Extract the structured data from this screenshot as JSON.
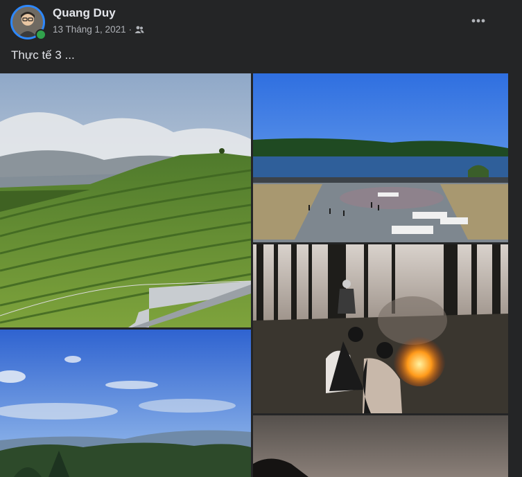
{
  "author": {
    "name": "Quang Duy",
    "online": true
  },
  "post": {
    "date": "13 Tháng 1, 2021",
    "separator": "·",
    "privacy_icon": "friends-icon",
    "text": "Thực tế 3 ...",
    "more_icon": "more-horizontal-icon"
  },
  "photos": [
    {
      "subject": "tea-hill"
    },
    {
      "subject": "lake-square"
    },
    {
      "subject": "blue-sky-mountains"
    },
    {
      "subject": "campfire-forest"
    },
    {
      "subject": "dusk-sky"
    }
  ],
  "colors": {
    "background": "#242526",
    "primary_text": "#e4e6eb",
    "secondary_text": "#b0b3b8",
    "online": "#31a24c",
    "avatar_ring": "#2d88ff"
  }
}
